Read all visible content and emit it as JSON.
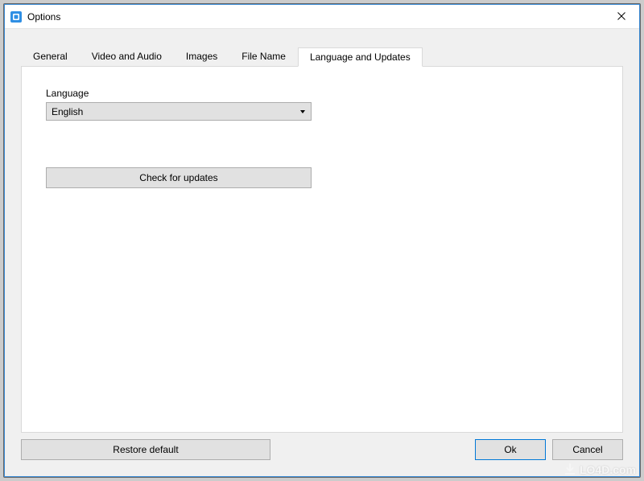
{
  "window": {
    "title": "Options",
    "close_symbol": "✕"
  },
  "tabs": [
    {
      "label": "General"
    },
    {
      "label": "Video and Audio"
    },
    {
      "label": "Images"
    },
    {
      "label": "File Name"
    },
    {
      "label": "Language and Updates"
    }
  ],
  "active_tab_index": 4,
  "panel": {
    "language_label": "Language",
    "language_value": "English",
    "check_updates_label": "Check for updates"
  },
  "footer": {
    "restore_label": "Restore default",
    "ok_label": "Ok",
    "cancel_label": "Cancel"
  },
  "watermark": {
    "text": "LO4D.com"
  }
}
